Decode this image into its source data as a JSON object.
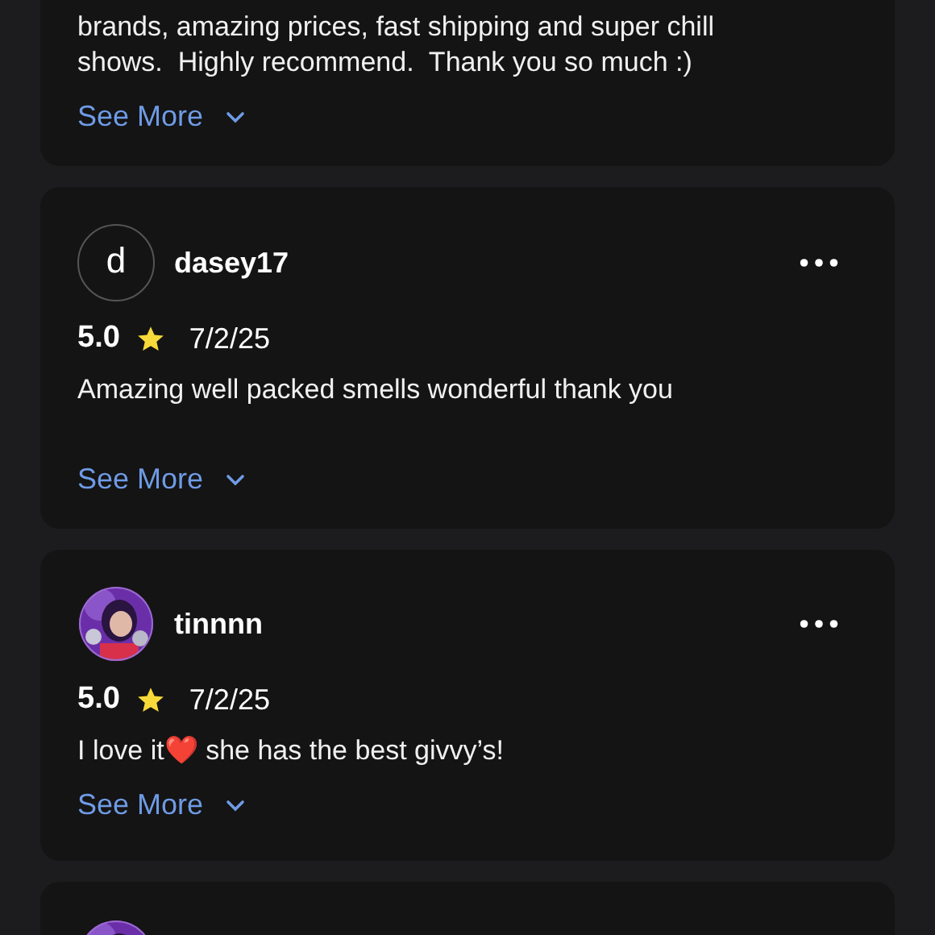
{
  "reviews": [
    {
      "body_lines": [
        "brands, amazing prices, fast shipping and super chill",
        "shows.  Highly recommend.  Thank you so much :)"
      ],
      "see_more": "See More"
    },
    {
      "avatar": {
        "kind": "letter",
        "letter": "d"
      },
      "username": "dasey17",
      "rating": "5.0",
      "date": "7/2/25",
      "body_lines": [
        "Amazing well packed smells wonderful thank you"
      ],
      "see_more": "See More"
    },
    {
      "avatar": {
        "kind": "picture"
      },
      "username": "tinnnn",
      "rating": "5.0",
      "date": "7/2/25",
      "body_lines": [
        "I love it❤️ she has the best givvy’s!"
      ],
      "see_more": "See More"
    },
    {
      "avatar": {
        "kind": "picture"
      }
    }
  ]
}
